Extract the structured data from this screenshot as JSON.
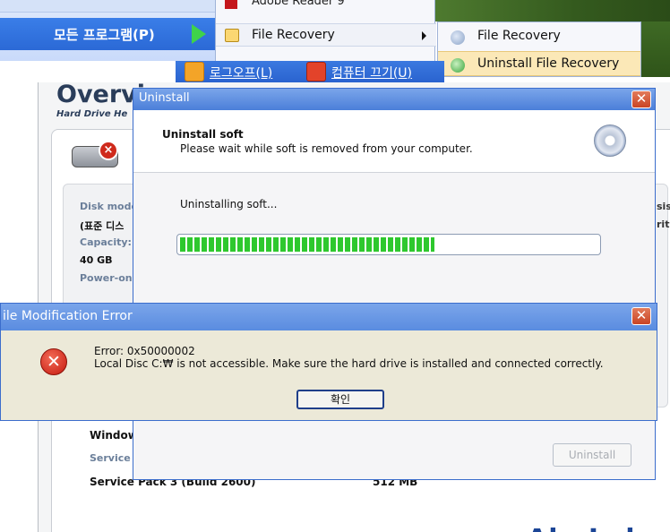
{
  "start_menu": {
    "all_programs_label": "모든 프로그램(P)",
    "program_item_partial": "Adobe Reader 9",
    "program_item_label": "File Recovery",
    "submenu": [
      {
        "label": "File Recovery"
      },
      {
        "label": "Uninstall File Recovery"
      }
    ],
    "logoff_label": "로그오프(L)",
    "shutdown_label": "컴퓨터 끄기(U)"
  },
  "background_app": {
    "title": "Overview",
    "subtitle": "Hard Drive He",
    "disk_model_label": "Disk mode",
    "disk_model_value": "(표준 디스",
    "capacity_label": "Capacity:",
    "capacity_value": "40 GB",
    "power_on_label": "Power-on",
    "right_label_1": "sis",
    "right_label_2": "rit",
    "windows_label": "Window",
    "service_label": "Service",
    "service_pack_value": "Service Pack 3 (Build 2600)",
    "memory_value": "512 MB",
    "brand": "AhnLab"
  },
  "uninstall_dialog": {
    "title": "Uninstall",
    "heading": "Uninstall soft",
    "subheading": "Please wait while soft is removed from your computer.",
    "status": "Uninstalling soft...",
    "progress_fraction": 0.61,
    "uninstall_button": "Uninstall",
    "close_glyph": "✕"
  },
  "error_dialog": {
    "title": "ile Modification Error",
    "line1": "Error: 0x50000002",
    "line2": "Local Disc C:₩ is not accessible. Make sure the hard drive is installed and connected correctly.",
    "ok_button": "확인",
    "close_glyph": "✕",
    "icon_glyph": "✕"
  },
  "colors": {
    "titlebar": "#4b7fd9",
    "progress": "#2ec82e",
    "error_icon": "#c51a10",
    "brand": "#1b4596"
  }
}
